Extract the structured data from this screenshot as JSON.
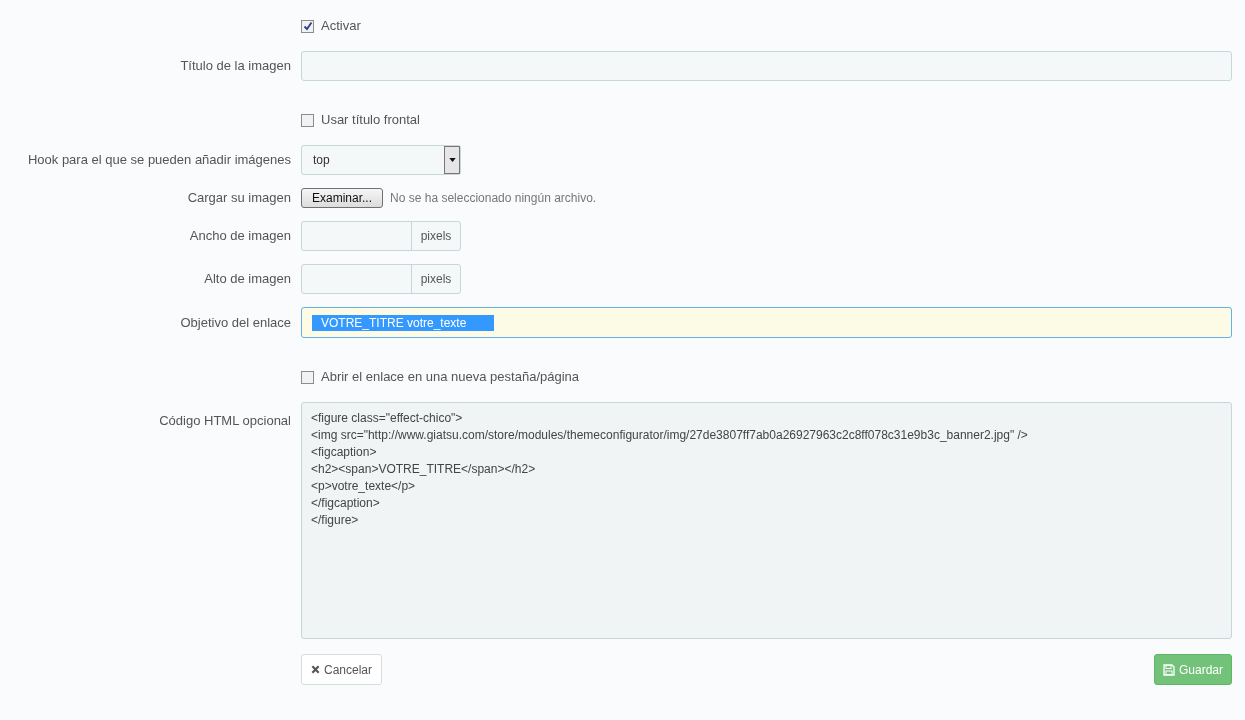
{
  "fields": [
    {
      "kind": "checkbox",
      "label": "Activar",
      "checked": true
    },
    {
      "kind": "text",
      "label": "Título de la imagen"
    },
    {
      "kind": "checkbox",
      "label": "Usar título frontal",
      "checked": false
    },
    {
      "kind": "select",
      "label": "Hook para el que se pueden añadir imágenes",
      "value": "top"
    },
    {
      "kind": "file",
      "label": "Cargar su imagen",
      "button": "Examinar...",
      "status": "No se ha seleccionado ningún archivo."
    },
    {
      "kind": "pixels",
      "label": "Ancho de imagen",
      "unit": "pixels"
    },
    {
      "kind": "pixels",
      "label": "Alto de imagen",
      "unit": "pixels"
    },
    {
      "kind": "highlight",
      "label": "Objetivo del enlace",
      "value": "VOTRE_TITRE votre_texte"
    },
    {
      "kind": "checkbox",
      "label": "Abrir el enlace en una nueva pestaña/página",
      "checked": false
    },
    {
      "kind": "code",
      "label": "Código HTML opcional",
      "lines": [
        "<figure class=\"effect-chico\">",
        "<img src=\"http://www.giatsu.com/store/modules/themeconfigurator/img/27de3807ff7ab0a26927963c2c8ff078c31e9b3c_banner2.jpg\" />",
        "<figcaption>",
        "<h2><span>VOTRE_TITRE</span></h2>",
        "<p>votre_texte</p>",
        "</figcaption>",
        "</figure>"
      ]
    }
  ],
  "buttons": {
    "cancel": "Cancelar",
    "save": "Guardar"
  }
}
